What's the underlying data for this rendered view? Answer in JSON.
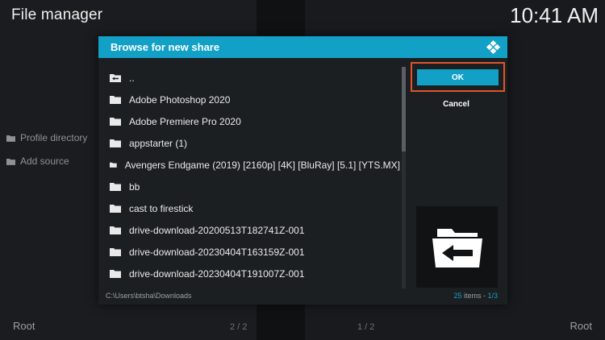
{
  "app": {
    "title": "File manager",
    "clock": "10:41 AM"
  },
  "sidebar": {
    "items": [
      {
        "label": "Profile directory",
        "icon": "folder-icon"
      },
      {
        "label": "Add source",
        "icon": "folder-icon"
      }
    ]
  },
  "footer": {
    "left": "Root",
    "center_left": "2 / 2",
    "center_right": "1 / 2",
    "right": "Root"
  },
  "dialog": {
    "title": "Browse for new share",
    "path": "C:\\Users\\btsha\\Downloads",
    "items_count": "25",
    "items_label": "items - ",
    "page": "1/3",
    "ok_label": "OK",
    "cancel_label": "Cancel",
    "accent_color": "#12a0c7",
    "highlight_color": "#e0542c",
    "list": [
      {
        "label": "..",
        "icon": "folder-up-icon"
      },
      {
        "label": "Adobe Photoshop 2020",
        "icon": "folder-icon"
      },
      {
        "label": "Adobe Premiere Pro 2020",
        "icon": "folder-icon"
      },
      {
        "label": "appstarter (1)",
        "icon": "folder-icon"
      },
      {
        "label": "Avengers Endgame (2019) [2160p] [4K] [BluRay] [5.1] [YTS.MX]",
        "icon": "folder-icon"
      },
      {
        "label": "bb",
        "icon": "folder-icon"
      },
      {
        "label": "cast to firestick",
        "icon": "folder-icon"
      },
      {
        "label": "drive-download-20200513T182741Z-001",
        "icon": "folder-icon"
      },
      {
        "label": "drive-download-20230404T163159Z-001",
        "icon": "folder-icon"
      },
      {
        "label": "drive-download-20230404T191007Z-001",
        "icon": "folder-icon"
      }
    ]
  }
}
